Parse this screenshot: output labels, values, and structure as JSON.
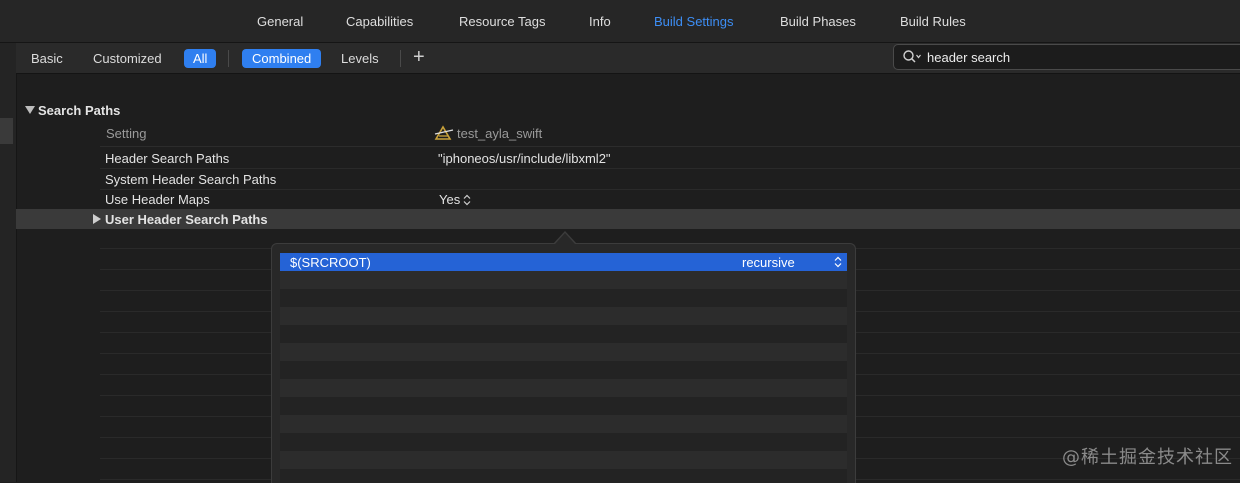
{
  "tabs": [
    {
      "label": "General",
      "active": false
    },
    {
      "label": "Capabilities",
      "active": false
    },
    {
      "label": "Resource Tags",
      "active": false
    },
    {
      "label": "Info",
      "active": false
    },
    {
      "label": "Build Settings",
      "active": true
    },
    {
      "label": "Build Phases",
      "active": false
    },
    {
      "label": "Build Rules",
      "active": false
    }
  ],
  "filter": {
    "basic": "Basic",
    "customized": "Customized",
    "all": "All",
    "combined": "Combined",
    "levels": "Levels",
    "add": "+"
  },
  "search": {
    "value": "header search"
  },
  "section": {
    "title": "Search Paths",
    "column_setting": "Setting",
    "column_target": "test_ayla_swift",
    "rows": [
      {
        "name": "Header Search Paths",
        "value": "\"iphoneos/usr/include/libxml2\""
      },
      {
        "name": "System Header Search Paths",
        "value": ""
      },
      {
        "name": "Use Header Maps",
        "value": "Yes"
      },
      {
        "name": "User Header Search Paths",
        "value": ""
      }
    ]
  },
  "popover": {
    "entries": [
      {
        "path": "$(SRCROOT)",
        "mode": "recursive"
      }
    ]
  },
  "watermark": "@稀土掘金技术社区",
  "colors": {
    "accent": "#3d8ef5",
    "selection": "#2563d6",
    "background": "#1e1e1e"
  }
}
